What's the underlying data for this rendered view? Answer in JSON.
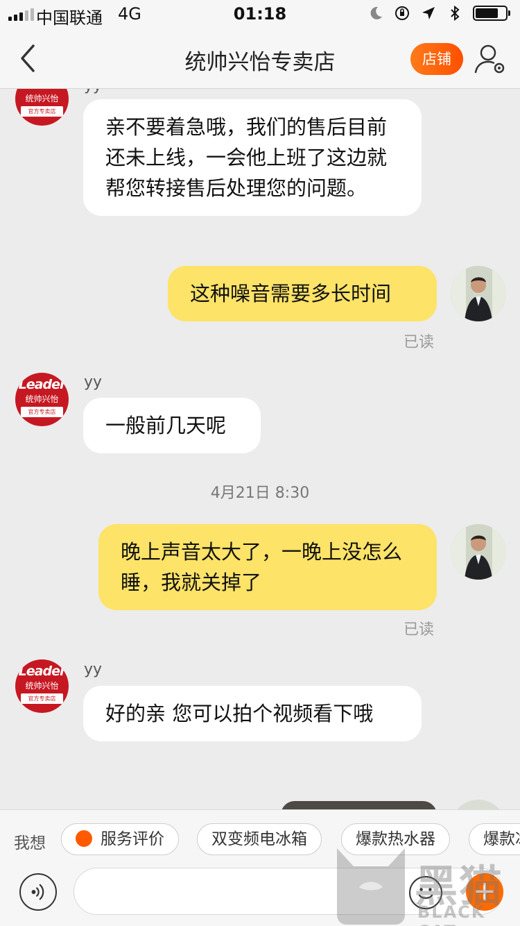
{
  "status_bar": {
    "carrier": "中国联通",
    "network": "4G",
    "time": "01:18",
    "battery_level": 0.75
  },
  "nav": {
    "title": "统帅兴怡专卖店",
    "shop_button": "店铺",
    "back_icon": "chevron-left-icon",
    "profile_icon": "user-settings-icon"
  },
  "store": {
    "avatar_brand": "Leader",
    "avatar_name": "统帅兴怡",
    "avatar_tag": "官方专卖店",
    "agent_name": "yy"
  },
  "messages": [
    {
      "from": "store",
      "text": "亲不要着急哦，我们的售后目前还未上线，一会他上班了这边就帮您转接售后处理您的问题。"
    },
    {
      "from": "user",
      "text": "这种噪音需要多长时间",
      "status": "已读"
    },
    {
      "from": "store",
      "sender": "yy",
      "text": "一般前几天呢"
    },
    {
      "from": "system",
      "text": "4月21日 8:30"
    },
    {
      "from": "user",
      "text": "晚上声音太大了，一晚上没怎么睡，我就关掉了",
      "status": "已读"
    },
    {
      "from": "store",
      "sender": "yy",
      "text": "好的亲 您可以拍个视频看下哦"
    }
  ],
  "quick_replies": {
    "label": "我想",
    "chips": [
      "服务评价",
      "双变频电冰箱",
      "爆款热水器",
      "爆款冰"
    ]
  },
  "input": {
    "placeholder": ""
  },
  "watermark": {
    "cn": "黑猫",
    "en": "BLACK CAT"
  },
  "colors": {
    "accent": "#ff5a00",
    "outgoing_bubble": "#fde368",
    "incoming_bubble": "#ffffff",
    "background": "#ececec"
  }
}
